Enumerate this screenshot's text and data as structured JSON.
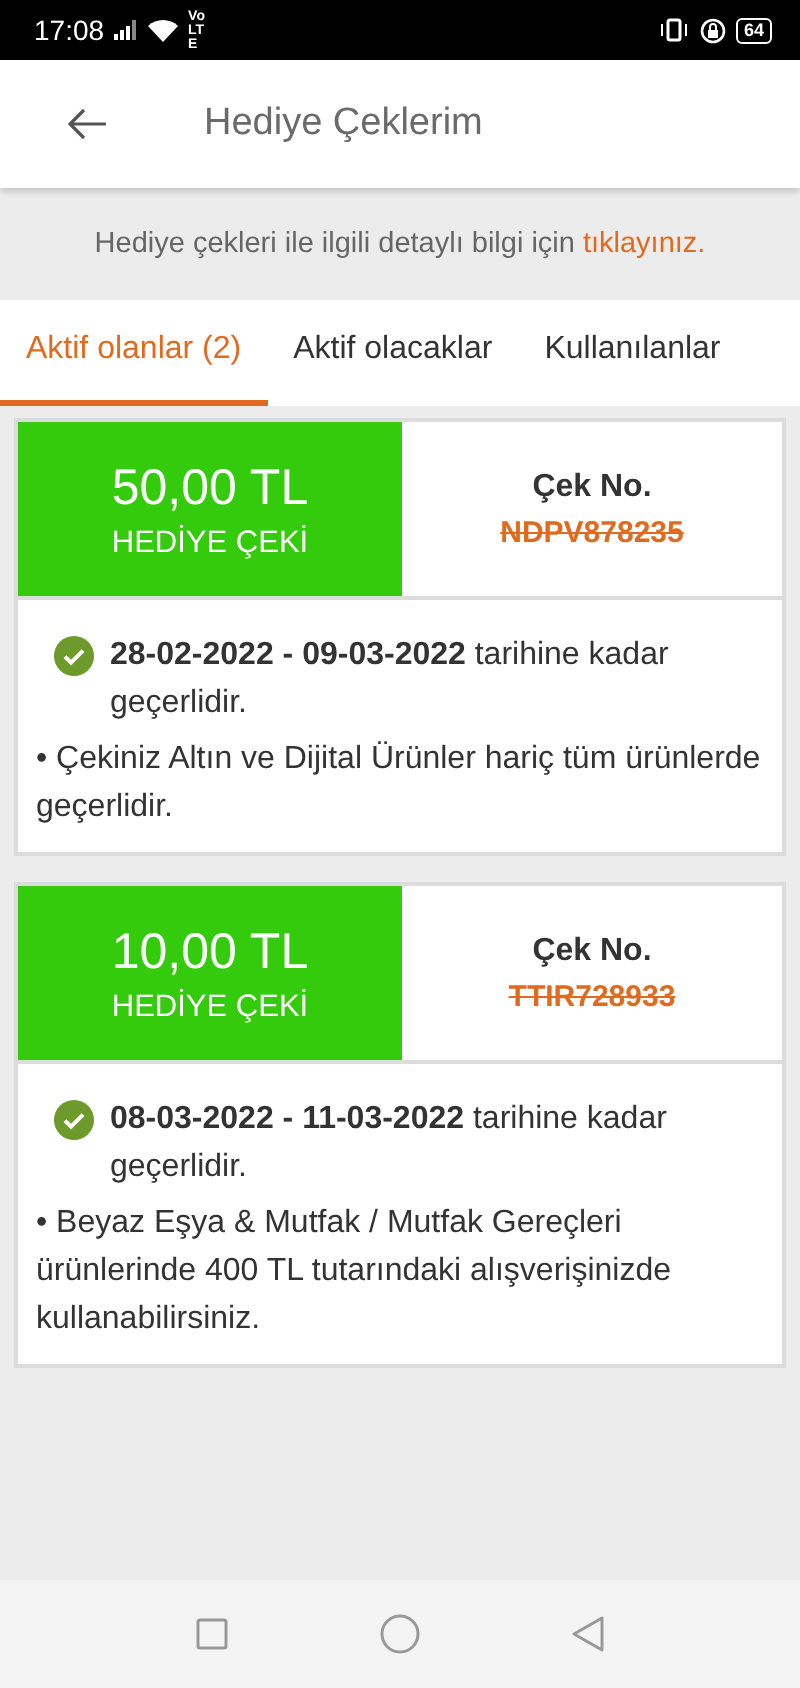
{
  "status_bar": {
    "time": "17:08",
    "network": "Vo LTE",
    "battery": "64"
  },
  "header": {
    "title": "Hediye Çeklerim"
  },
  "info": {
    "text": "Hediye çekleri ile ilgili detaylı bilgi için",
    "link": "tıklayınız."
  },
  "tabs": [
    {
      "label": "Aktif olanlar (2)",
      "selected": true
    },
    {
      "label": "Aktif olacaklar",
      "selected": false
    },
    {
      "label": "Kullanılanlar",
      "selected": false
    }
  ],
  "vouchers": [
    {
      "amount": "50,00 TL",
      "caption": "HEDİYE ÇEKİ",
      "code_label": "Çek No.",
      "code": "NDPV878235",
      "struck_through": true,
      "validity": "**28-02-2022 - 09-03-2022** tarihine kadar geçerlidir.",
      "valid": true,
      "note": "• Çekiniz Altın ve Dijital Ürünler hariç tüm ürünlerde geçerlidir."
    },
    {
      "amount": "10,00 TL",
      "caption": "HEDİYE ÇEKİ",
      "code_label": "Çek No.",
      "code": "TTIR728933",
      "struck_through": true,
      "validity": "**08-03-2022 - 11-03-2022** tarihine kadar geçerlidir.",
      "valid": true,
      "note": "• Beyaz Eşya & Mutfak / Mutfak Gereçleri ürünlerinde 400 TL tutarındaki alışverişinizde kullanabilirsiniz."
    }
  ]
}
